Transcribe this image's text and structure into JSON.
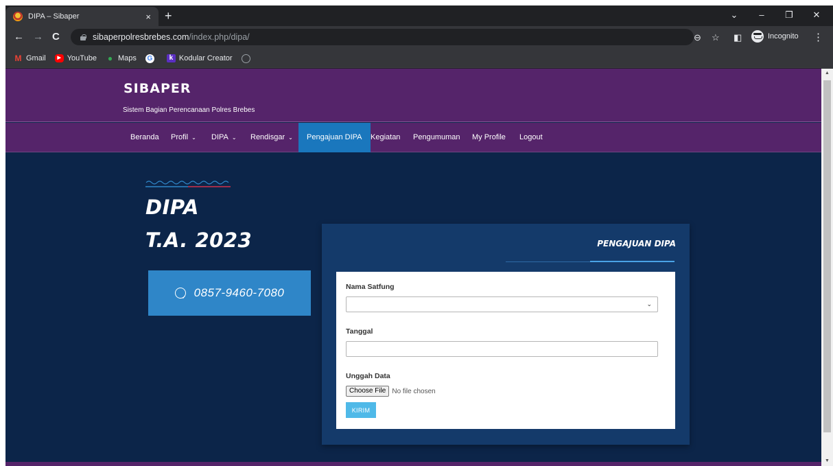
{
  "browser": {
    "tab_title": "DIPA – Sibaper",
    "tab_close": "×",
    "new_tab": "+",
    "window_controls": {
      "list": "⌄",
      "minimize": "–",
      "restore": "❐",
      "close": "✕"
    },
    "nav": {
      "back": "←",
      "forward": "→",
      "reload": "C"
    },
    "url_host": "sibaperpolresbrebes.com",
    "url_path": "/index.php/dipa/",
    "zoom_icon": "⊖",
    "star_icon": "☆",
    "sidepanel_icon": "◧",
    "incognito_label": "Incognito",
    "menu_icon": "⋮",
    "bookmarks": [
      {
        "label": "Gmail",
        "icon": "M"
      },
      {
        "label": "YouTube",
        "icon": "▶"
      },
      {
        "label": "Maps",
        "icon": "●"
      },
      {
        "label": "",
        "icon": "G"
      },
      {
        "label": "Kodular Creator",
        "icon": "k"
      },
      {
        "label": "",
        "icon": ""
      }
    ]
  },
  "site": {
    "logo": "SIBAPER",
    "tagline": "Sistem Bagian Perencanaan Polres Brebes",
    "nav": [
      {
        "label": "Beranda"
      },
      {
        "label": "Profil",
        "chevron": "⌄"
      },
      {
        "label": "DIPA",
        "chevron": "⌄"
      },
      {
        "label": "Rendisgar",
        "chevron": "⌄"
      },
      {
        "label": "Pengajuan DIPA",
        "active": true
      },
      {
        "label": "Kegiatan"
      },
      {
        "label": "Pengumuman"
      },
      {
        "label": "My Profile"
      },
      {
        "label": "Logout"
      }
    ]
  },
  "hero": {
    "title_line1": "DIPA",
    "title_line2": "T.A. 2023",
    "phone": "0857-9460-7080",
    "phone_icon": "whatsapp-icon"
  },
  "form": {
    "card_title": "PENGAJUAN DIPA",
    "satfung_label": "Nama Satfung",
    "satfung_value": "",
    "select_arrow": "⌄",
    "tanggal_label": "Tanggal",
    "tanggal_value": "",
    "upload_label": "Unggah Data",
    "file_button": "Choose File",
    "file_status": "No file chosen",
    "submit_label": "KIRIM"
  },
  "colors": {
    "header_purple": "#55246a",
    "nav_active": "#1a77bd",
    "page_bg": "#0c2549",
    "card_bg": "#143a6a",
    "phone_btn": "#2f86c8",
    "submit_btn": "#4fb9e8"
  }
}
